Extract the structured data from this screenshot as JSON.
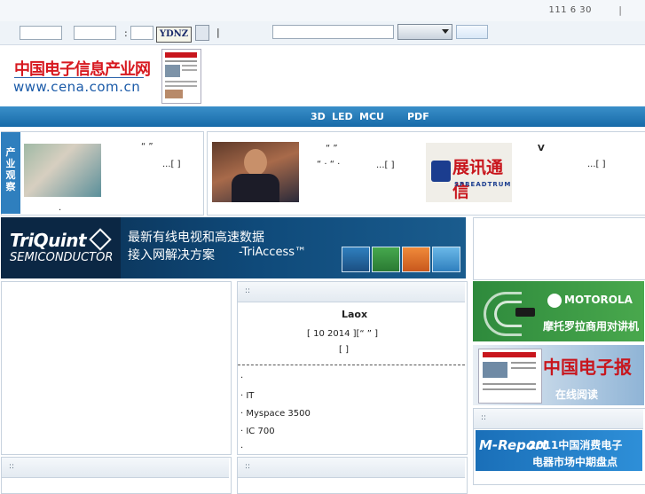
{
  "topbar": {
    "date": "111 6 30",
    "separator": "|"
  },
  "searchbar": {
    "colon": ":",
    "brand_button": "YDNZ",
    "bar_char": "|"
  },
  "logo": {
    "cn": "中国电子信息产业网",
    "url": "www.cena.com.cn"
  },
  "nav": {
    "items": [
      "3D",
      "LED",
      "MCU",
      "PDF"
    ]
  },
  "sidebar_tag": "产业观察",
  "features": [
    {
      "quote": "“ ”",
      "more": "...[ ]",
      "foot": "."
    },
    {
      "quote": "“ ”",
      "line2": "“ ·   “ ·",
      "more": "...[ ]"
    },
    {
      "brand": "展讯通信",
      "brand_en": "SPREADTRUM",
      "letter": "V",
      "more": "...[ ]"
    }
  ],
  "banner": {
    "logo": "TriQuint",
    "logo_sub": "SEMICONDUCTOR",
    "line1": "最新有线电视和高速数据",
    "line2": "接入网解决方案",
    "product": "-TriAccess™"
  },
  "news_panel": {
    "head": "::",
    "headline": "Laox",
    "meta": "[ 10  2014  ][“  ”  ]",
    "meta2": "[     ]",
    "items": [
      "·",
      "·        IT",
      "· Myspace  3500",
      "·    IC           700",
      "·"
    ]
  },
  "bottom_left_head": "::",
  "bottom_mid_head": "::",
  "right_head": "::",
  "motorola": {
    "brand": "MOTOROLA",
    "cn": "摩托罗拉商用对讲机"
  },
  "epaper": {
    "title": "中国电子报",
    "read": "在线阅读"
  },
  "mreport": {
    "brand": "M-Report",
    "line1": "2011中国消费电子",
    "line2": "电器市场中期盘点"
  }
}
